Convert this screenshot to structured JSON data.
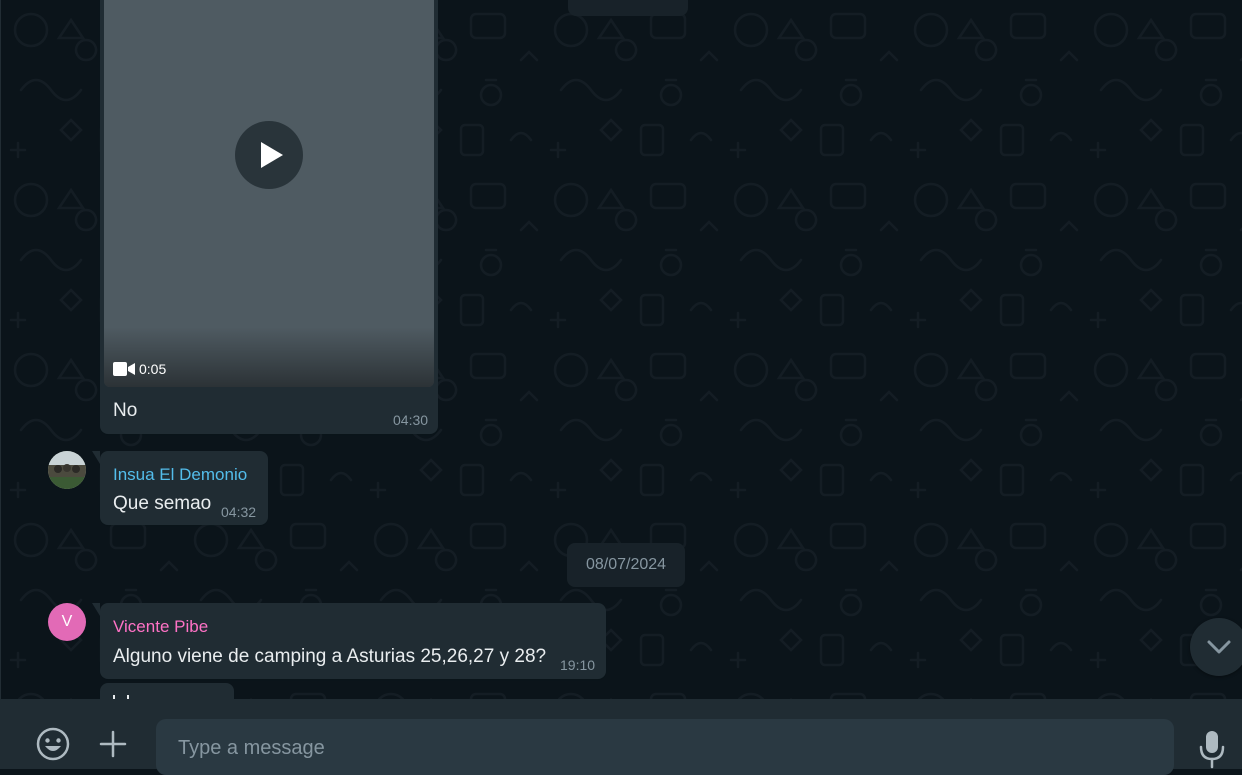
{
  "messages": {
    "video": {
      "duration": "0:05",
      "caption": "No",
      "time": "04:30"
    },
    "insua": {
      "sender": "Insua El Demonio",
      "text": "Que semao",
      "time": "04:32"
    },
    "date_separator": "08/07/2024",
    "vicente": {
      "sender": "Vicente Pibe",
      "avatar_letter": "V",
      "text": "Alguno viene de camping a Asturias 25,26,27 y 28?",
      "time": "19:10"
    }
  },
  "composer": {
    "placeholder": "Type a message"
  },
  "icons": {
    "emoji": "emoji-icon",
    "attach": "plus-icon",
    "mic": "mic-icon",
    "scroll": "chevron-down-icon",
    "play": "play-icon",
    "video": "video-camera-icon"
  },
  "colors": {
    "background": "#0b141a",
    "incoming_bubble": "#202c33",
    "insua_name": "#53bdeb",
    "vicente_name": "#ff72c6",
    "vicente_avatar": "#e26ab6",
    "secondary_text": "#8696a0"
  }
}
